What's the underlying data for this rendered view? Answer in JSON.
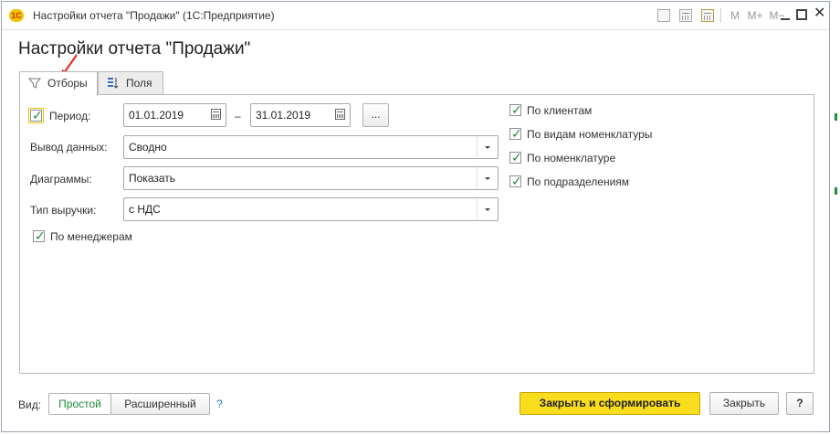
{
  "window": {
    "title": "Настройки отчета \"Продажи\"  (1С:Предприятие)",
    "logo_text": "1С",
    "toolbar": {
      "m_label": "M",
      "m_plus_label": "M+",
      "m_minus_label": "M−"
    }
  },
  "form": {
    "heading": "Настройки отчета \"Продажи\"",
    "tabs": [
      {
        "label": "Отборы",
        "icon": "filter-icon",
        "active": true
      },
      {
        "label": "Поля",
        "icon": "fields-icon",
        "active": false
      }
    ],
    "period": {
      "label": "Период:",
      "checked": true,
      "date_from": "01.01.2019",
      "dash": "–",
      "date_to": "31.01.2019",
      "more_button": "..."
    },
    "output": {
      "label": "Вывод данных:",
      "value": "Сводно"
    },
    "charts": {
      "label": "Диаграммы:",
      "value": "Показать"
    },
    "revenue_type": {
      "label": "Тип выручки:",
      "value": "с НДС"
    },
    "by_managers": {
      "label": "По менеджерам",
      "checked": true
    },
    "right_options": [
      {
        "label": "По клиентам",
        "checked": true
      },
      {
        "label": "По видам номенклатуры",
        "checked": true
      },
      {
        "label": "По номенклатуре",
        "checked": true
      },
      {
        "label": "По подразделениям",
        "checked": true
      }
    ]
  },
  "footer": {
    "view_label": "Вид:",
    "simple_label": "Простой",
    "extended_label": "Расширенный",
    "help_link": "?",
    "close_and_build": "Закрыть и сформировать",
    "close": "Закрыть",
    "help_button": "?"
  },
  "colors": {
    "accent_green": "#1e8a3c",
    "primary_button": "#f8dc1e",
    "annotation_arrow": "#e8221b"
  }
}
